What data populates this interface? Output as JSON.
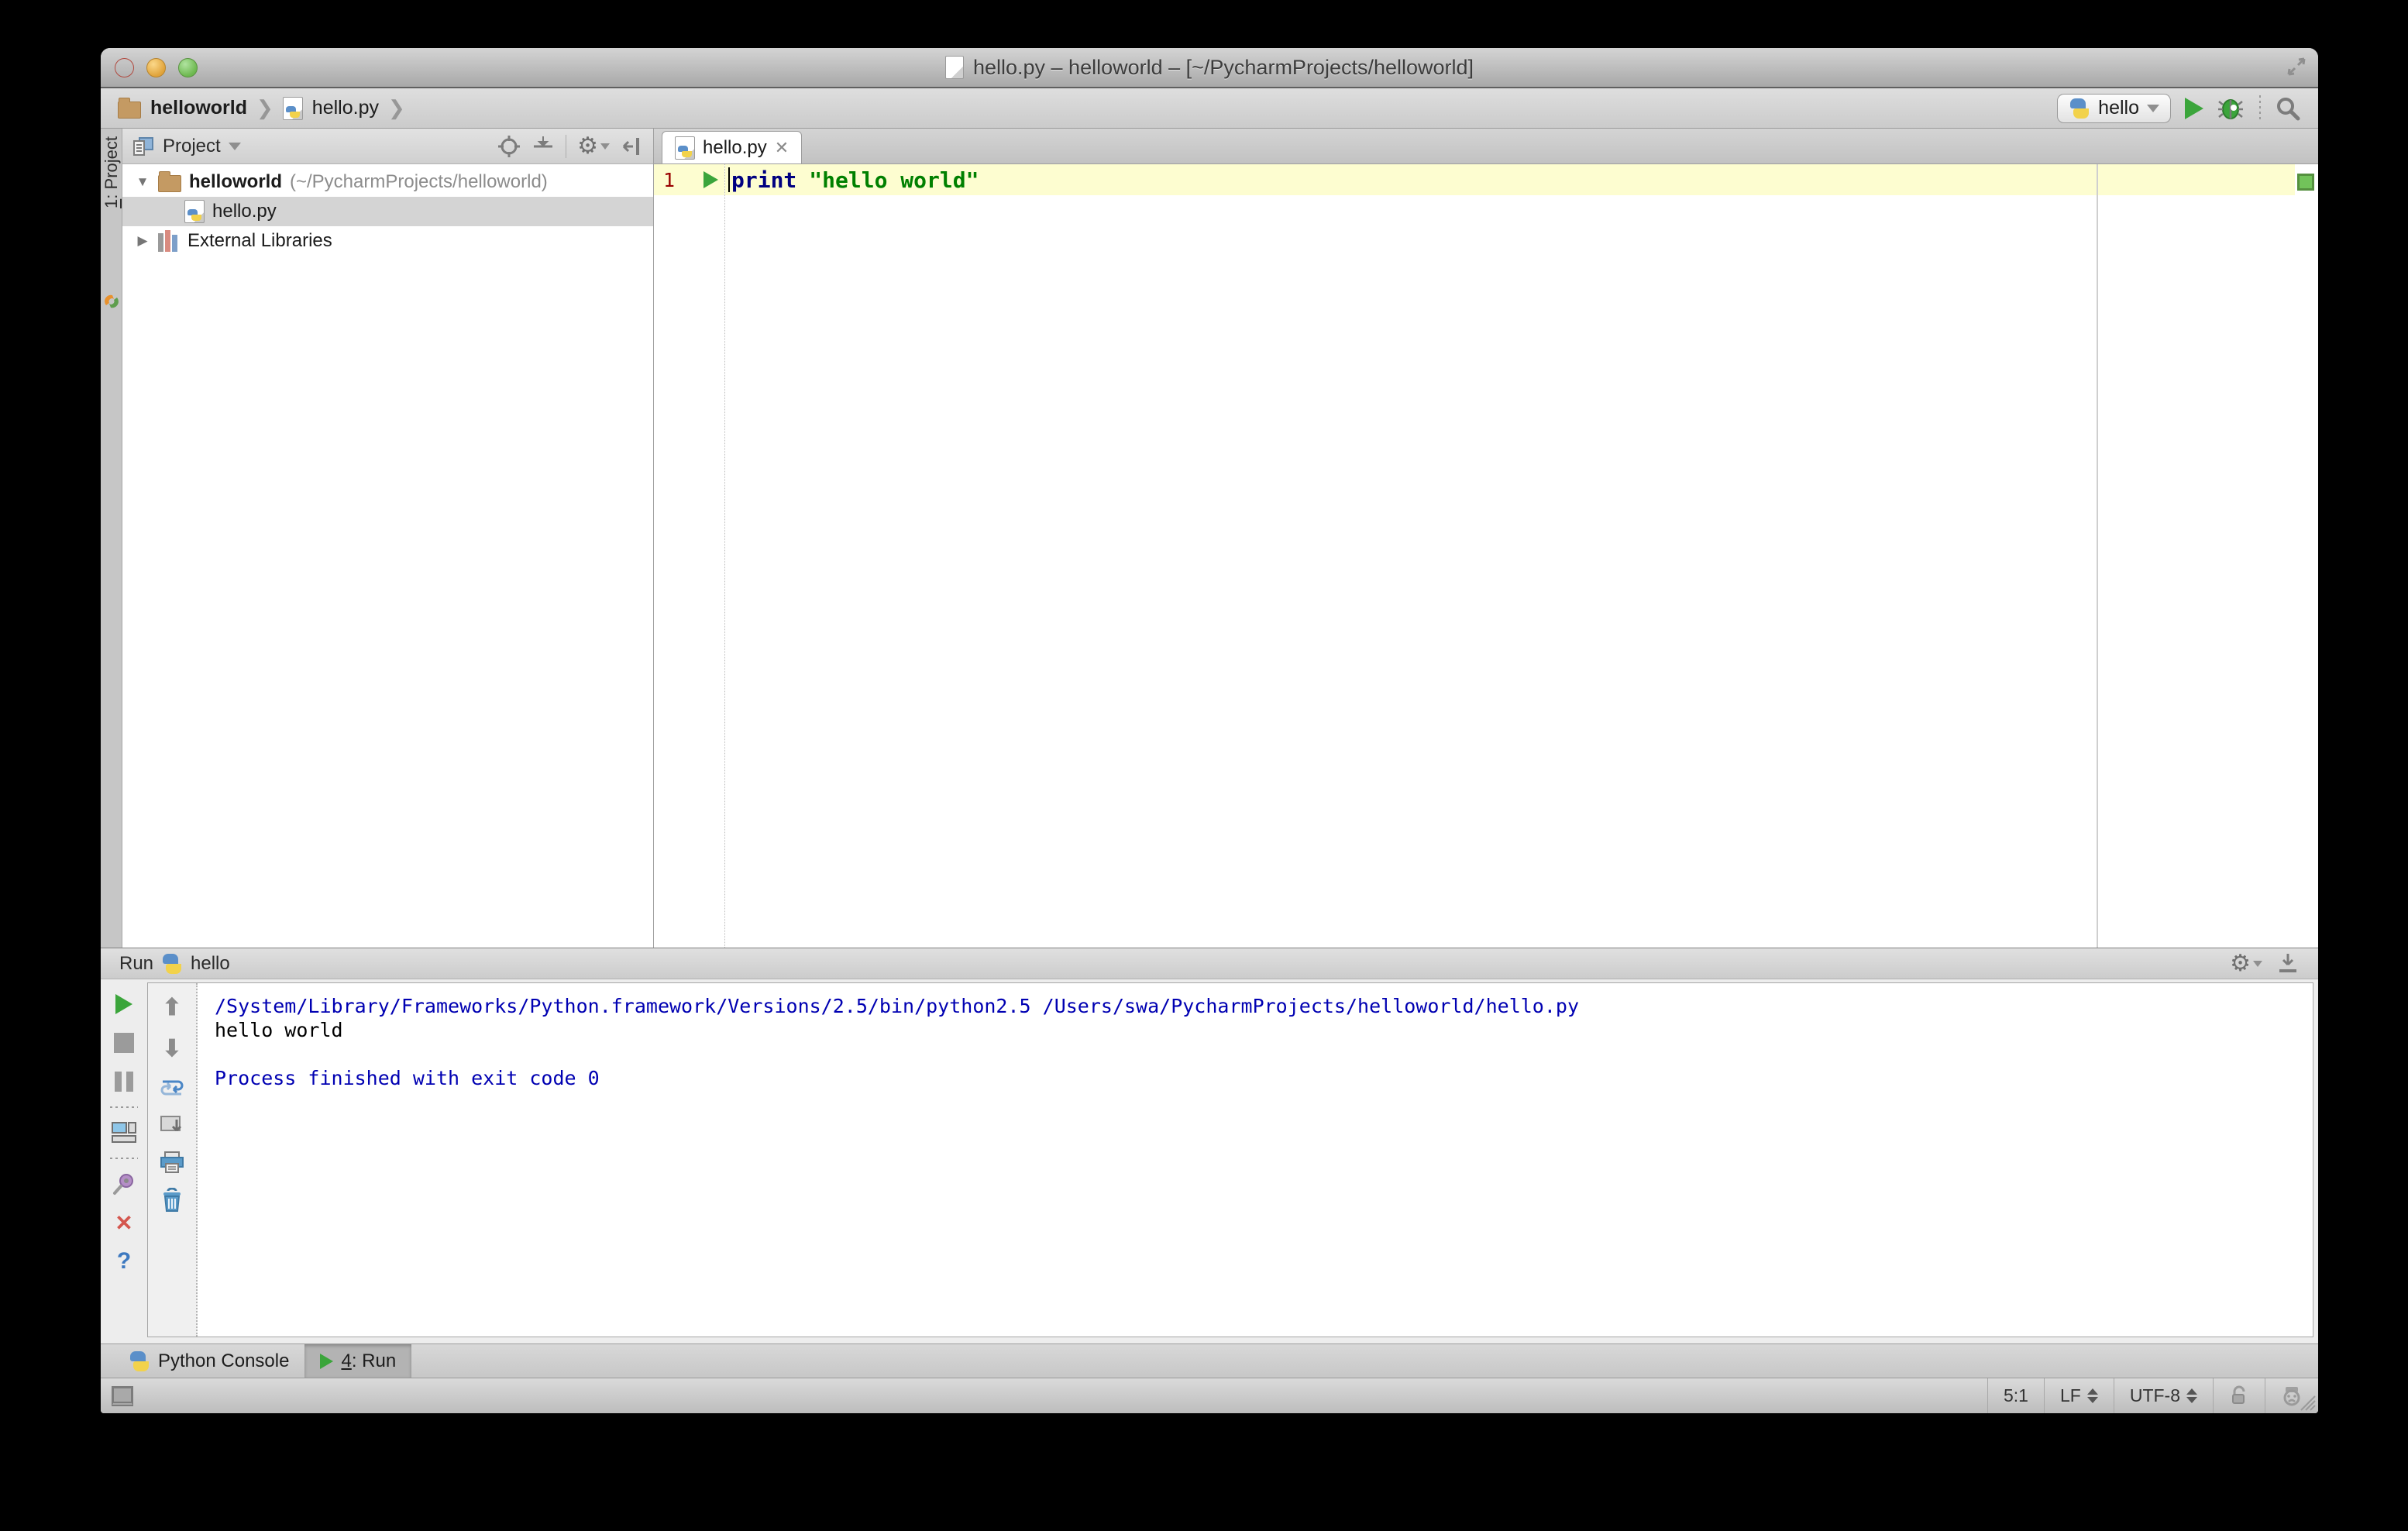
{
  "window": {
    "title": "hello.py – helloworld – [~/PycharmProjects/helloworld]"
  },
  "navbar": {
    "breadcrumbs": [
      {
        "label": "helloworld"
      },
      {
        "label": "hello.py"
      }
    ],
    "run_config": "hello"
  },
  "tool_strip": {
    "mnemonic": "1",
    "label": ": Project"
  },
  "project_panel": {
    "header": "Project",
    "tree": [
      {
        "name": "helloworld",
        "detail": "(~/PycharmProjects/helloworld)"
      },
      {
        "name": "hello.py"
      },
      {
        "name": "External Libraries"
      }
    ]
  },
  "editor": {
    "tab": "hello.py",
    "close_glyph": "✕",
    "line_number": "1",
    "code": {
      "keyword": "print",
      "string": "\"hello world\""
    }
  },
  "run_panel": {
    "title": "Run",
    "config": "hello",
    "console_lines": [
      {
        "text": "/System/Library/Frameworks/Python.framework/Versions/2.5/bin/python2.5 /Users/swa/PycharmProjects/helloworld/hello.py"
      },
      {
        "text": "hello world"
      },
      {
        "text": ""
      },
      {
        "text": "Process finished with exit code 0"
      }
    ]
  },
  "bottom_bar": {
    "tabs": [
      {
        "label": "Python Console"
      },
      {
        "mnemonic": "4",
        "label": ": Run"
      }
    ]
  },
  "status_bar": {
    "position": "5:1",
    "line_ending": "LF",
    "encoding": "UTF-8"
  },
  "colors": {
    "console_system_text": "#0000b2",
    "console_stdout_text": "#000000",
    "keyword": "#000080",
    "string": "#008000",
    "line_number": "#990000",
    "current_line_highlight": "#fdfdd0",
    "run_green": "#3ba53b",
    "inspection_ok_green": "#72c35a",
    "selected_row": "#d4d4d4"
  }
}
